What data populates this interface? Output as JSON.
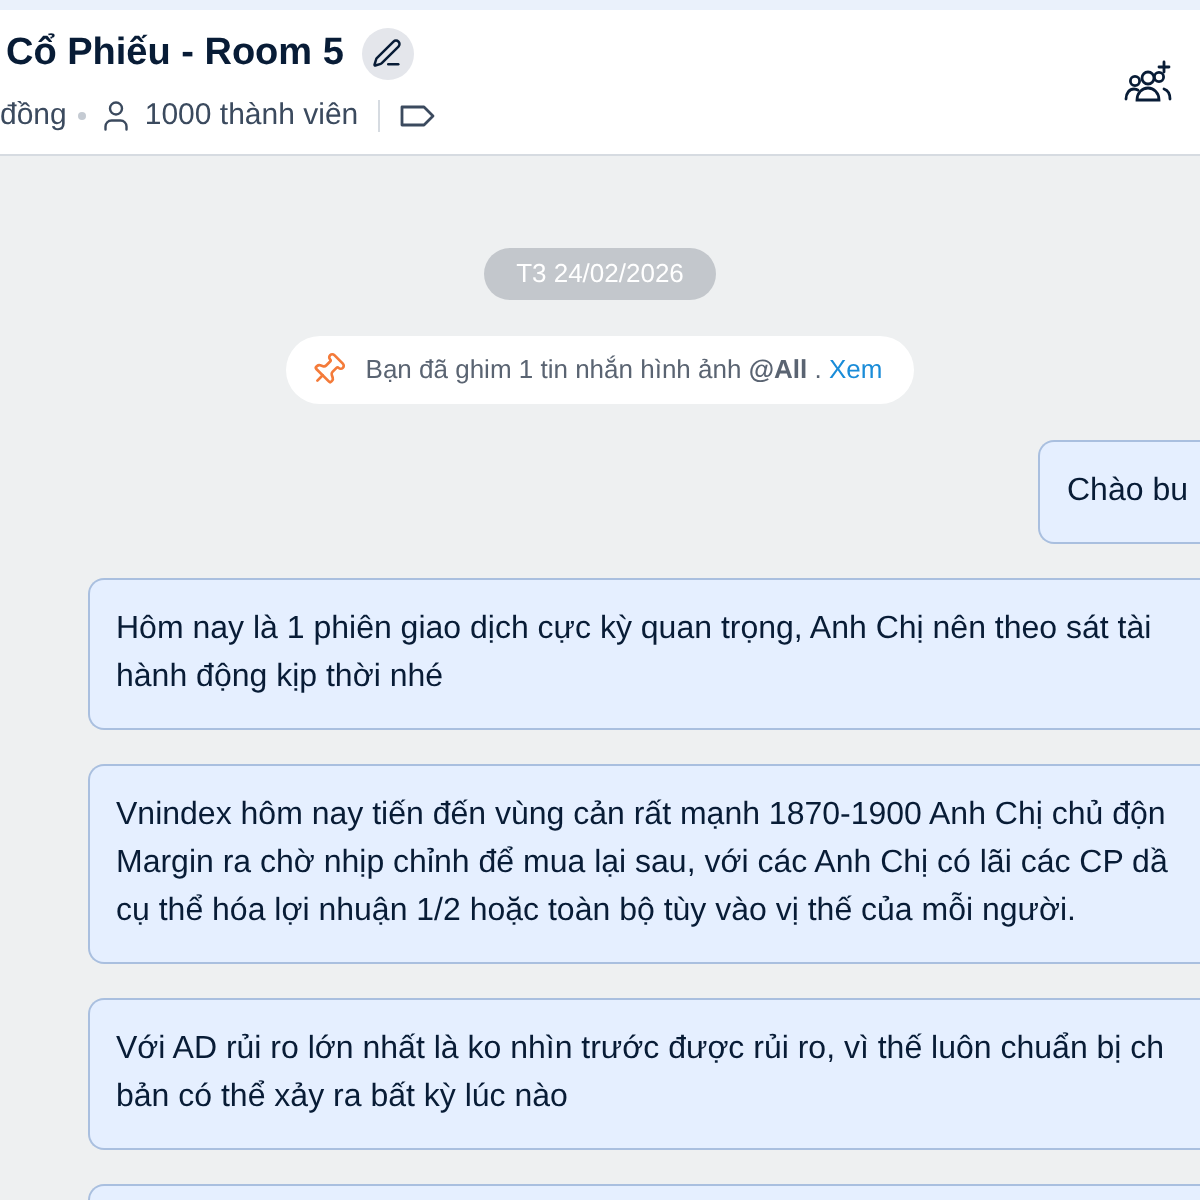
{
  "header": {
    "title": "Cổ Phiếu - Room 5",
    "status": "đồng",
    "members": "1000 thành viên"
  },
  "date_separator": "T3 24/02/2026",
  "pin_notice": {
    "text": "Bạn đã ghim 1 tin nhắn hình ảnh **@All** .",
    "link": "Xem"
  },
  "messages": [
    {
      "kind": "sent",
      "lines": [
        "Chào bu"
      ]
    },
    {
      "kind": "received",
      "lines": [
        "Hôm nay là 1 phiên giao dịch cực kỳ quan trọng, Anh Chị nên theo sát tài",
        "hành động kịp thời nhé"
      ]
    },
    {
      "kind": "received",
      "lines": [
        "Vnindex hôm nay tiến đến vùng cản rất mạnh 1870-1900 Anh Chị chủ độn",
        "Margin ra chờ nhịp chỉnh để mua lại sau, với các Anh Chị có lãi các CP dầ",
        "cụ thể hóa lợi nhuận 1/2 hoặc toàn bộ tùy vào vị thế của mỗi người."
      ]
    },
    {
      "kind": "received",
      "lines": [
        "Với AD rủi ro lớn nhất là ko nhìn trước được rủi ro, vì thế luôn chuẩn bị ch",
        "bản có thể xảy ra bất kỳ lúc nào"
      ]
    },
    {
      "kind": "received"
    }
  ]
}
